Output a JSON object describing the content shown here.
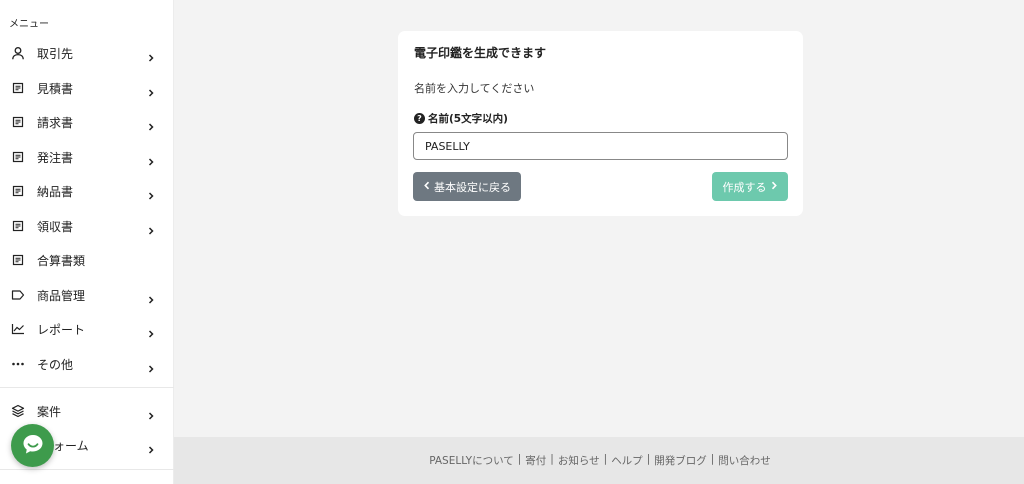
{
  "sidebar": {
    "heading": "メニュー",
    "items": [
      {
        "label": "取引先",
        "icon": "user-icon"
      },
      {
        "label": "見積書",
        "icon": "document-icon"
      },
      {
        "label": "請求書",
        "icon": "document-icon"
      },
      {
        "label": "発注書",
        "icon": "document-icon"
      },
      {
        "label": "納品書",
        "icon": "document-icon"
      },
      {
        "label": "領収書",
        "icon": "document-icon"
      },
      {
        "label": "合算書類",
        "icon": "document-icon"
      },
      {
        "label": "商品管理",
        "icon": "tag-icon"
      },
      {
        "label": "レポート",
        "icon": "line-chart-icon"
      },
      {
        "label": "その他",
        "icon": "more-icon"
      },
      {
        "label": "案件",
        "icon": "layers-icon"
      },
      {
        "label": "ォーム",
        "icon": "form-icon"
      }
    ]
  },
  "card": {
    "title": "電子印鑑を生成できます",
    "description": "名前を入力してください",
    "field_label": "名前(5文字以内)",
    "input_value": "PASELLY",
    "back_label": "基本設定に戻る",
    "create_label": "作成する"
  },
  "footer": {
    "links": [
      "PASELLYについて",
      "寄付",
      "お知らせ",
      "ヘルプ",
      "開発ブログ",
      "問い合わせ"
    ],
    "separator": "|"
  },
  "colors": {
    "back_button": "#6e7881",
    "create_button": "#6dc9ad",
    "chat_button": "#3e9b4c"
  }
}
